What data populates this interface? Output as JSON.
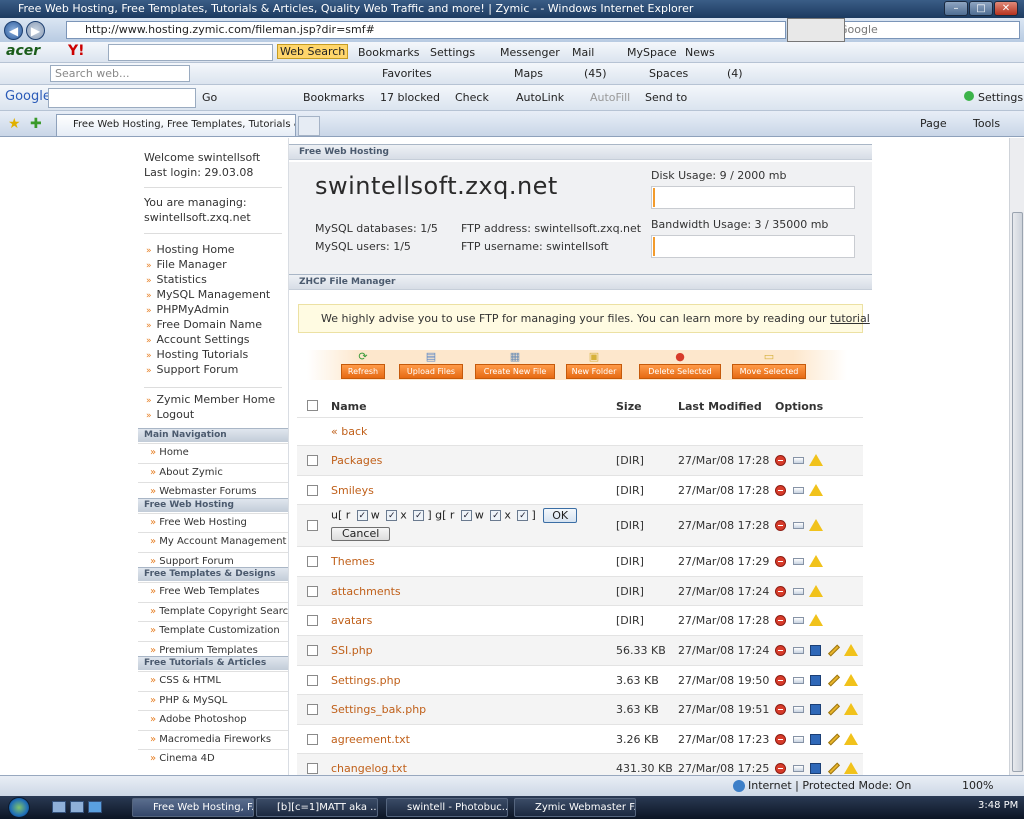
{
  "window": {
    "title": "Free Web Hosting, Free Templates, Tutorials & Articles, Quality Web Traffic and more! | Zymic - - Windows Internet Explorer",
    "url": "http://www.hosting.zymic.com/fileman.jsp?dir=smf#",
    "search_placeholder": "Google"
  },
  "toolbar_acer": {
    "brand": "acer",
    "yahoo": "Y!",
    "web_search": "Web Search",
    "bookmarks": "Bookmarks",
    "settings": "Settings",
    "messenger": "Messenger",
    "mail": "Mail",
    "myspace": "MySpace",
    "news": "News"
  },
  "toolbar_msn": {
    "search_placeholder": "Search web...",
    "favorites": "Favorites",
    "maps": "Maps",
    "mail_count": "(45)",
    "spaces": "Spaces",
    "contacts_count": "(4)"
  },
  "toolbar_google": {
    "brand": "Google",
    "go": "Go",
    "bookmarks": "Bookmarks",
    "blocked": "17 blocked",
    "check": "Check",
    "autolink": "AutoLink",
    "autofill": "AutoFill",
    "sendto": "Send to",
    "settings": "Settings"
  },
  "tabs": {
    "active_tab": "Free Web Hosting, Free Templates, Tutorials & Ar...",
    "page": "Page",
    "tools": "Tools"
  },
  "sidebar": {
    "welcome": "Welcome swintellsoft",
    "last_login": "Last login: 29.03.08",
    "managing_label": "You are managing:",
    "managing_domain": "swintellsoft.zxq.net",
    "links": [
      "Hosting Home",
      "File Manager",
      "Statistics",
      "MySQL Management",
      "PHPMyAdmin",
      "Free Domain Name",
      "Account Settings",
      "Hosting Tutorials",
      "Support Forum"
    ],
    "links2": [
      "Zymic Member Home",
      "Logout"
    ],
    "sections": [
      {
        "title": "Main Navigation",
        "items": [
          "Home",
          "About Zymic",
          "Webmaster Forums"
        ]
      },
      {
        "title": "Free Web Hosting",
        "items": [
          "Free Web Hosting",
          "My Account Management",
          "Support Forum"
        ]
      },
      {
        "title": "Free Templates & Designs",
        "items": [
          "Free Web Templates",
          "Template Copyright Search",
          "Template Customization",
          "Premium Templates"
        ]
      },
      {
        "title": "Free Tutorials & Articles",
        "items": [
          "CSS & HTML",
          "PHP & MySQL",
          "Adobe Photoshop",
          "Macromedia Fireworks",
          "Cinema 4D"
        ]
      }
    ]
  },
  "hosting": {
    "section_title": "Free Web Hosting",
    "domain": "swintellsoft.zxq.net",
    "mysql_databases": "MySQL databases: 1/5",
    "mysql_users": "MySQL users: 1/5",
    "ftp_address": "FTP address: swintellsoft.zxq.net",
    "ftp_username": "FTP username: swintellsoft",
    "disk_usage": "Disk Usage: 9 / 2000 mb",
    "disk_fraction": 0.0045,
    "bandwidth_usage": "Bandwidth Usage: 3 / 35000 mb",
    "bandwidth_fraction": 0.0001
  },
  "filemanager": {
    "section_title": "ZHCP File Manager",
    "advice_text": "We highly advise you to use FTP for managing your files. You can learn more by reading our",
    "advice_link": "tutorial",
    "actions": [
      "Refresh",
      "Upload Files",
      "Create New File",
      "New Folder",
      "Delete Selected",
      "Move Selected"
    ],
    "columns": {
      "name": "Name",
      "size": "Size",
      "modified": "Last Modified",
      "options": "Options"
    },
    "back": "« back",
    "perm": {
      "u": "u[",
      "r": "r",
      "w": "w",
      "x": "x",
      "close": "]",
      "g": "g[",
      "ok": "OK",
      "cancel": "Cancel"
    },
    "files": [
      {
        "name": "Packages",
        "size": "[DIR]",
        "modified": "27/Mar/08 17:28",
        "dir": true
      },
      {
        "name": "Smileys",
        "size": "[DIR]",
        "modified": "27/Mar/08 17:28",
        "dir": true
      },
      {
        "name": "",
        "size": "[DIR]",
        "modified": "27/Mar/08 17:28",
        "dir": true
      },
      {
        "name": "Themes",
        "size": "[DIR]",
        "modified": "27/Mar/08 17:29",
        "dir": true
      },
      {
        "name": "attachments",
        "size": "[DIR]",
        "modified": "27/Mar/08 17:24",
        "dir": true
      },
      {
        "name": "avatars",
        "size": "[DIR]",
        "modified": "27/Mar/08 17:28",
        "dir": true
      },
      {
        "name": "SSI.php",
        "size": "56.33 KB",
        "modified": "27/Mar/08 17:24",
        "dir": false
      },
      {
        "name": "Settings.php",
        "size": "3.63 KB",
        "modified": "27/Mar/08 19:50",
        "dir": false
      },
      {
        "name": "Settings_bak.php",
        "size": "3.63 KB",
        "modified": "27/Mar/08 19:51",
        "dir": false
      },
      {
        "name": "agreement.txt",
        "size": "3.26 KB",
        "modified": "27/Mar/08 17:23",
        "dir": false
      },
      {
        "name": "changelog.txt",
        "size": "431.30 KB",
        "modified": "27/Mar/08 17:25",
        "dir": false
      }
    ]
  },
  "statusbar": {
    "zone": "Internet | Protected Mode: On",
    "zoom": "100%"
  },
  "taskbar": {
    "tasks": [
      "Free Web Hosting, F...",
      "[b][c=1]MATT aka ...",
      "swintell - Photobuc...",
      "Zymic Webmaster F..."
    ],
    "time": "3:48 PM"
  }
}
